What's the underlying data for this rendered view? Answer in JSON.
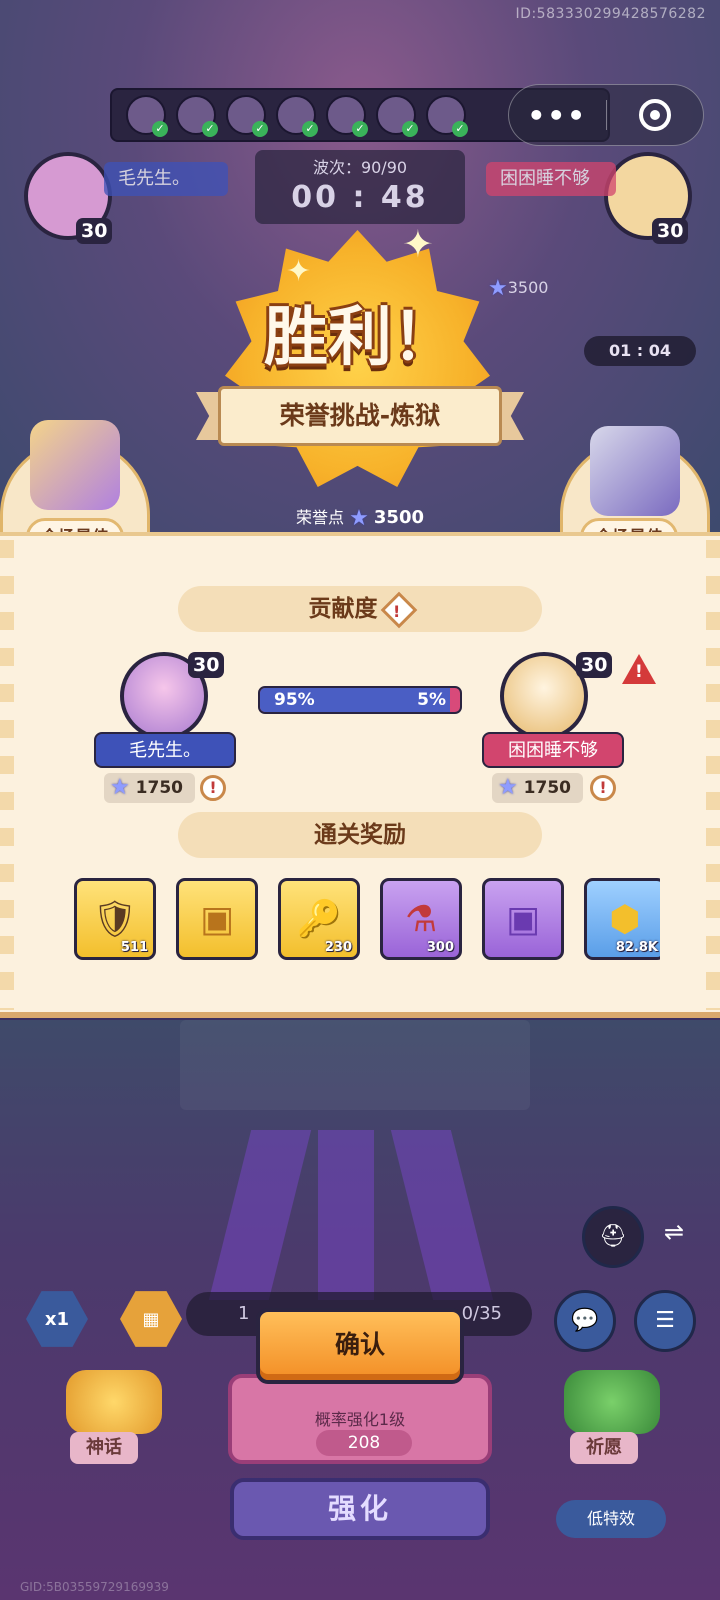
{
  "header": {
    "player_id": "ID:583330299428576282",
    "wave_label": "波次：90/90",
    "timer": "00 : 48",
    "small_timer": "01 : 04",
    "honor_small": "3500"
  },
  "capsule": {
    "more_icon": "more-dots-icon",
    "close_icon": "target-close-icon"
  },
  "victory": {
    "title": "胜利！",
    "mode": "荣誉挑战-炼狱",
    "honor_label": "荣誉点",
    "honor_value": "3500",
    "mvp_label": "全场最佳"
  },
  "contribution": {
    "title": "贡献度",
    "left_percent": "95%",
    "right_percent": "5%",
    "left_fraction": 0.95,
    "players": [
      {
        "name": "毛先生。",
        "level": "30",
        "score": "1750",
        "name_color": "#3e52b8"
      },
      {
        "name": "困困睡不够",
        "level": "30",
        "score": "1750",
        "name_color": "#d2456e"
      }
    ]
  },
  "rewards": {
    "title": "通关奖励",
    "items": [
      {
        "icon": "shield-eye-icon",
        "glyph": "🛡",
        "qty": "511",
        "tier": "gold"
      },
      {
        "icon": "treasure-chest-icon",
        "glyph": "▣",
        "qty": "",
        "tier": "gold"
      },
      {
        "icon": "hex-key-icon",
        "glyph": "🔑",
        "qty": "230",
        "tier": "gold"
      },
      {
        "icon": "potion-bottle-icon",
        "glyph": "⚗",
        "qty": "300",
        "tier": "purple"
      },
      {
        "icon": "purple-chest-icon",
        "glyph": "▣",
        "qty": "",
        "tier": "purple"
      },
      {
        "icon": "gold-coin-icon",
        "glyph": "⬢",
        "qty": "82.8K",
        "tier": "blue"
      }
    ]
  },
  "controls": {
    "confirm": "确认",
    "speed": "x1",
    "myth": "神话",
    "wish": "祈愿",
    "upgrade_text": "概率强化1级",
    "upgrade_cost": "208",
    "enhance": "强化",
    "low_fx": "低特效",
    "resource_tail": "0/35",
    "resource_head": "1"
  },
  "footer": {
    "gid": "GID:5B03559729169939"
  }
}
